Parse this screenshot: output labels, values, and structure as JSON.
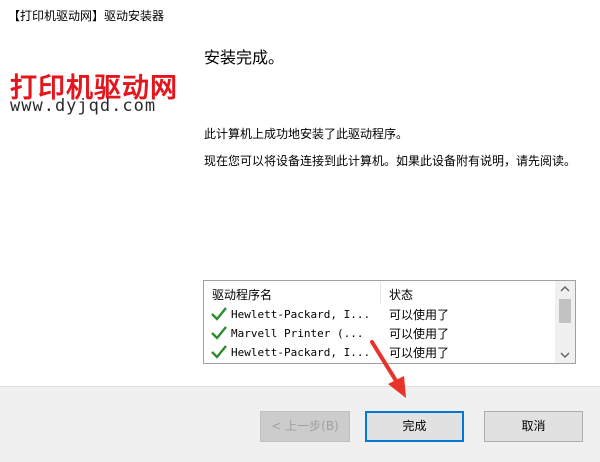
{
  "window": {
    "title": "【打印机驱动网】驱动安装器"
  },
  "logo": {
    "name": "打印机驱动网",
    "url": "www.dyjqd.com"
  },
  "content": {
    "heading": "安装完成。",
    "message1": "此计算机上成功地安装了此驱动程序。",
    "message2": "现在您可以将设备连接到此计算机。如果此设备附有说明，请先阅读。"
  },
  "driver_list": {
    "columns": [
      "驱动程序名",
      "状态"
    ],
    "rows": [
      {
        "name": "Hewlett-Packard, I...",
        "status": "可以使用了",
        "icon": "checkmark-icon"
      },
      {
        "name": "Marvell Printer  (...",
        "status": "可以使用了",
        "icon": "checkmark-icon"
      },
      {
        "name": "Hewlett-Packard, I...",
        "status": "可以使用了",
        "icon": "checkmark-icon"
      }
    ]
  },
  "buttons": {
    "back": "< 上一步(B)",
    "finish": "完成",
    "cancel": "取消"
  },
  "colors": {
    "accent": "#0078d7",
    "logo_red": "#e4151c",
    "check_green": "#2e8b2e",
    "annotation_red": "#e8322a"
  }
}
